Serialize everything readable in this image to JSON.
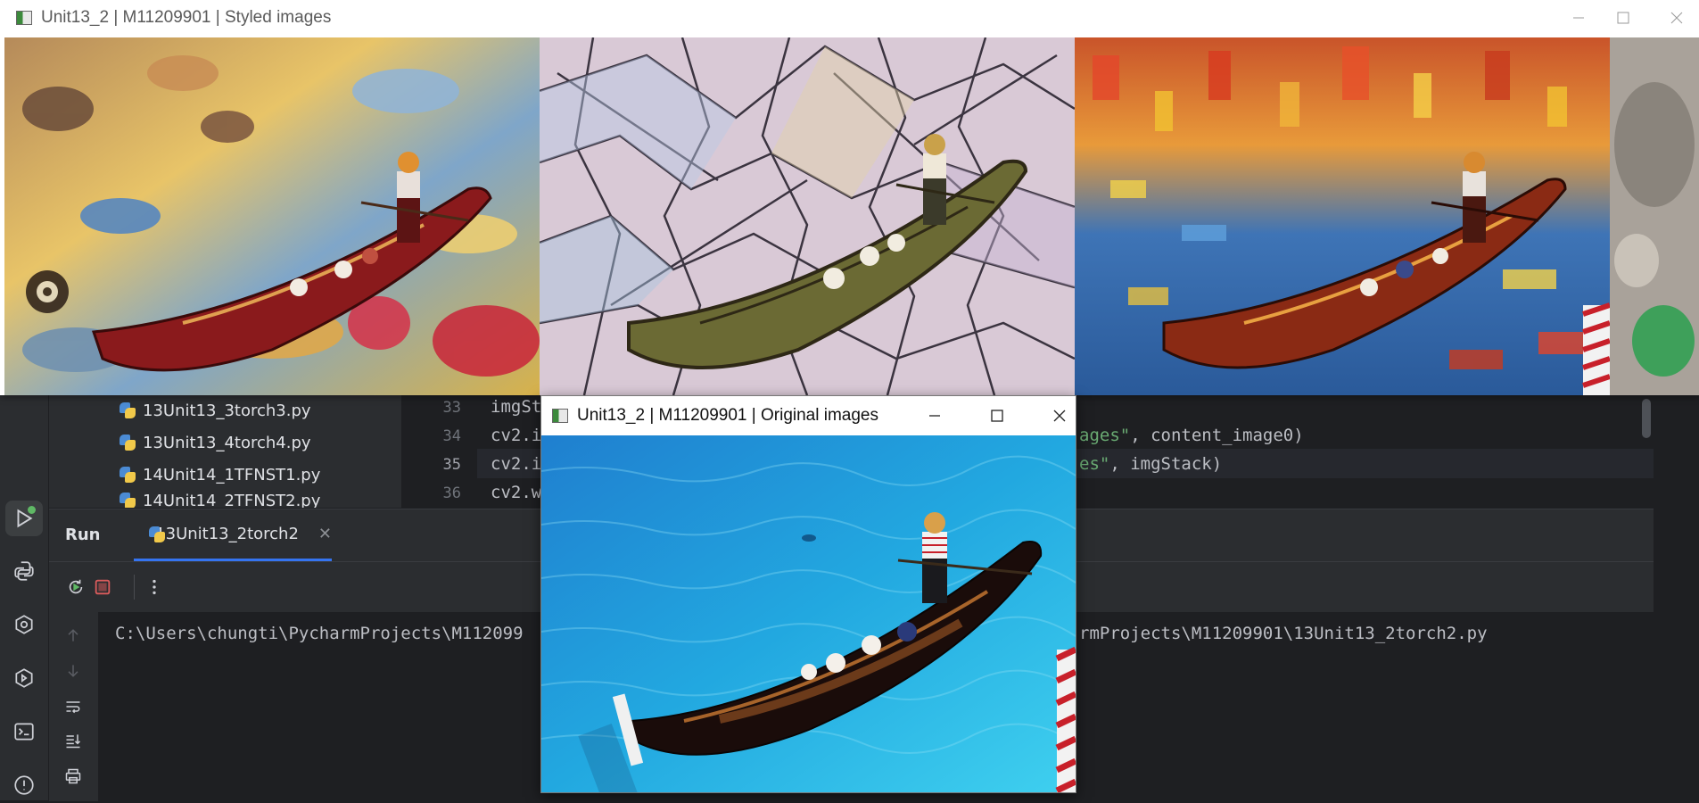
{
  "styled_window": {
    "title": "Unit13_2 | M11209901 | Styled images",
    "controls": [
      "minimize",
      "maximize",
      "close"
    ],
    "panels": [
      "style-1",
      "style-2-stained-glass",
      "style-3-mosaic",
      "style-4-partial"
    ]
  },
  "original_window": {
    "title": "Unit13_2 | M11209901 | Original images"
  },
  "project_tree": {
    "items": [
      {
        "label": "13Unit13_3torch3.py"
      },
      {
        "label": "13Unit13_4torch4.py"
      },
      {
        "label": "14Unit14_1TFNST1.py"
      },
      {
        "label": "14Unit14_2TFNST2.py"
      }
    ]
  },
  "editor": {
    "lines": [
      {
        "number": "33",
        "code_left": "imgSt",
        "code_right": ""
      },
      {
        "number": "34",
        "code_left": "cv2.i",
        "code_right_str": "ages\"",
        "code_right": ", content_image0)"
      },
      {
        "number": "35",
        "code_left": "cv2.i",
        "code_right_str": "es\"",
        "code_right": ", imgStack)"
      },
      {
        "number": "36",
        "code_left": "cv2.w",
        "code_right": ""
      }
    ]
  },
  "run_panel": {
    "title": "Run",
    "tab_label": "13Unit13_2torch2",
    "console_left": "C:\\Users\\chungti\\PycharmProjects\\M112099",
    "console_right": "rmProjects\\M11209901\\13Unit13_2torch2.py"
  },
  "icons": {
    "left_strip": [
      "run-icon",
      "python-console-icon",
      "python-packages-icon",
      "services-icon",
      "terminal-icon",
      "problems-icon"
    ],
    "run_toolbar": [
      "rerun-icon",
      "stop-icon",
      "more-icon"
    ],
    "run_sidebar": [
      "up-arrow-icon",
      "down-arrow-icon",
      "soft-wrap-icon",
      "scroll-to-end-icon",
      "print-icon"
    ]
  },
  "colors": {
    "ide_bg": "#1e1f22",
    "ide_panel": "#2b2d30",
    "string_green": "#6aab73",
    "tab_underline": "#3574f0",
    "stop_red": "#db5c5c",
    "run_dot": "#5fb865"
  }
}
